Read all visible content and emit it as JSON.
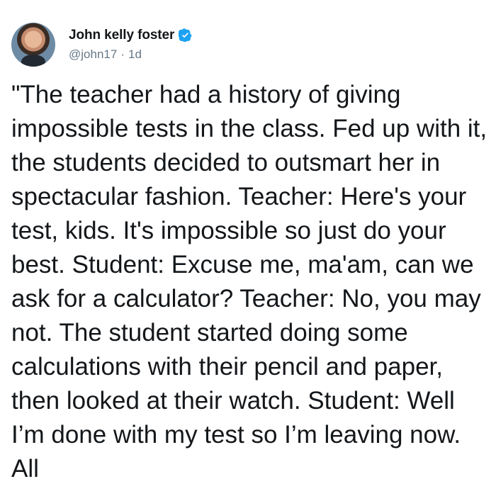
{
  "author": {
    "display_name": "John kelly foster",
    "handle": "@john17",
    "separator": "·",
    "timestamp": "1d",
    "verified": true
  },
  "tweet": {
    "text": "\"The teacher had a history of giving impossible tests in the class. Fed up with it, the students decided to outsmart her in spectacular fashion. Teacher: Here's your test, kids. It's impossible so just do your best. Student: Excuse me, ma'am, can we ask for a calculator? Teacher: No, you may not. The student started doing some calculations with their pencil and paper, then looked at their watch. Student: Well I’m done with my test so I’m leaving now. All"
  },
  "icons": {
    "avatar": "profile-photo",
    "verified": "verified-badge-icon"
  },
  "colors": {
    "text": "#14171a",
    "secondary": "#657786",
    "verified": "#1da1f2",
    "background": "#ffffff"
  }
}
